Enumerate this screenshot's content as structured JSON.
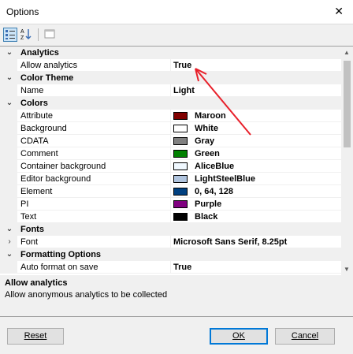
{
  "window": {
    "title": "Options",
    "close_glyph": "✕"
  },
  "toolbar": {
    "categorized_icon": "categorized-icon",
    "alphabetical_icon": "alphabetical-sort-icon",
    "pages_icon": "property-pages-icon"
  },
  "grid": {
    "rows": [
      {
        "type": "cat",
        "label": "Analytics",
        "expander": "⌄"
      },
      {
        "type": "prop",
        "name": "Allow analytics",
        "value": "True"
      },
      {
        "type": "cat",
        "label": "Color Theme",
        "expander": "⌄"
      },
      {
        "type": "prop",
        "name": "Name",
        "value": "Light"
      },
      {
        "type": "cat",
        "label": "Colors",
        "expander": "⌄"
      },
      {
        "type": "color",
        "name": "Attribute",
        "value": "Maroon",
        "color": "#800000"
      },
      {
        "type": "color",
        "name": "Background",
        "value": "White",
        "color": "#ffffff"
      },
      {
        "type": "color",
        "name": "CDATA",
        "value": "Gray",
        "color": "#808080"
      },
      {
        "type": "color",
        "name": "Comment",
        "value": "Green",
        "color": "#008000"
      },
      {
        "type": "color",
        "name": "Container background",
        "value": "AliceBlue",
        "color": "#f0f8ff"
      },
      {
        "type": "color",
        "name": "Editor background",
        "value": "LightSteelBlue",
        "color": "#b0c4de"
      },
      {
        "type": "color",
        "name": "Element",
        "value": "0, 64, 128",
        "color": "#004080"
      },
      {
        "type": "color",
        "name": "PI",
        "value": "Purple",
        "color": "#800080"
      },
      {
        "type": "color",
        "name": "Text",
        "value": "Black",
        "color": "#000000"
      },
      {
        "type": "cat",
        "label": "Fonts",
        "expander": "⌄"
      },
      {
        "type": "prop",
        "name": "Font",
        "value": "Microsoft Sans Serif, 8.25pt",
        "expander": "›"
      },
      {
        "type": "cat",
        "label": "Formatting Options",
        "expander": "⌄"
      },
      {
        "type": "prop",
        "name": "Auto format on save",
        "value": "True"
      }
    ]
  },
  "help": {
    "title": "Allow analytics",
    "description": "Allow anonymous analytics to be collected"
  },
  "buttons": {
    "reset": "Reset",
    "ok": "OK",
    "cancel": "Cancel"
  },
  "colors": {
    "annotation_arrow": "#e8202a",
    "accent": "#0078d7"
  }
}
